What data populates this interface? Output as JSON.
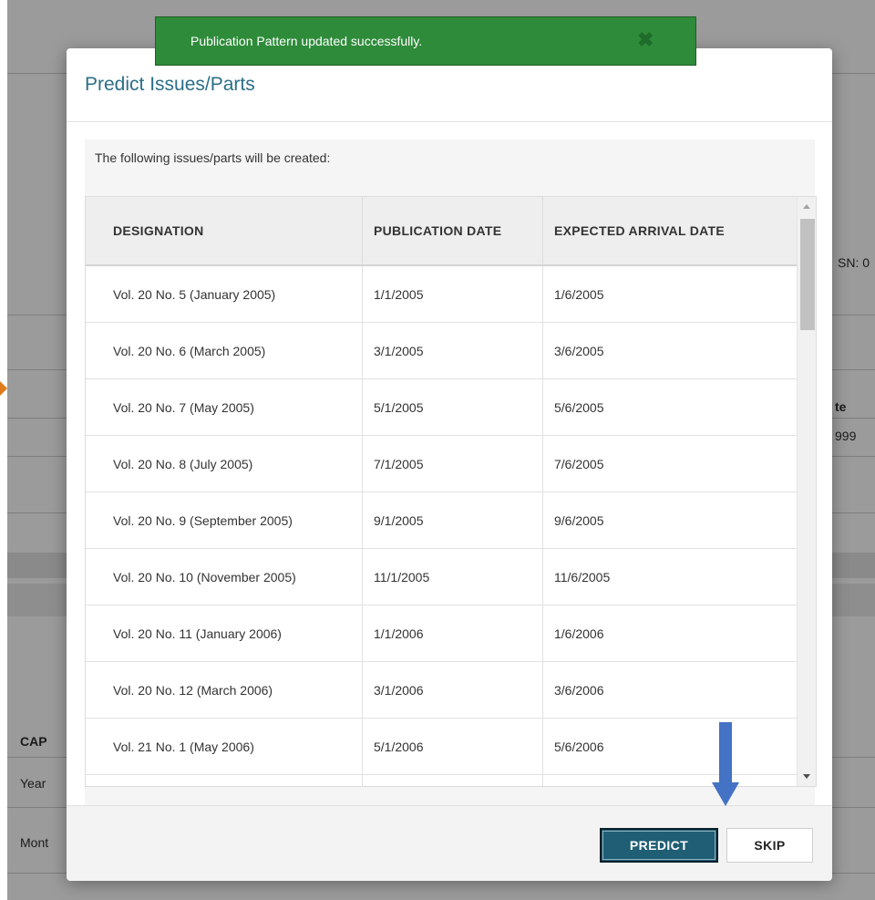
{
  "toast": {
    "message": "Publication Pattern updated successfully.",
    "close_icon": "close-icon"
  },
  "background": {
    "issn_fragment": "SN: 0",
    "date_header_fragment": "te",
    "date_value_fragment": "999",
    "caption_fragment": "CAP",
    "year_fragment": "Year",
    "month_fragment": "Mont"
  },
  "modal": {
    "title": "Predict Issues/Parts",
    "intro": "The following issues/parts will be created:",
    "table": {
      "headers": [
        "DESIGNATION",
        "PUBLICATION DATE",
        "EXPECTED ARRIVAL DATE"
      ],
      "rows": [
        [
          "Vol. 20 No. 5 (January 2005)",
          "1/1/2005",
          "1/6/2005"
        ],
        [
          "Vol. 20 No. 6 (March 2005)",
          "3/1/2005",
          "3/6/2005"
        ],
        [
          "Vol. 20 No. 7 (May 2005)",
          "5/1/2005",
          "5/6/2005"
        ],
        [
          "Vol. 20 No. 8 (July 2005)",
          "7/1/2005",
          "7/6/2005"
        ],
        [
          "Vol. 20 No. 9 (September 2005)",
          "9/1/2005",
          "9/6/2005"
        ],
        [
          "Vol. 20 No. 10 (November 2005)",
          "11/1/2005",
          "11/6/2005"
        ],
        [
          "Vol. 20 No. 11 (January 2006)",
          "1/1/2006",
          "1/6/2006"
        ],
        [
          "Vol. 20 No. 12 (March 2006)",
          "3/1/2006",
          "3/6/2006"
        ],
        [
          "Vol. 21 No. 1 (May 2006)",
          "5/1/2006",
          "5/6/2006"
        ]
      ]
    },
    "buttons": {
      "predict": "PREDICT",
      "skip": "SKIP"
    }
  },
  "annotations": {
    "blue_arrow_color": "#4472c4",
    "orange_arrow_color": "#e07a1c"
  },
  "colors": {
    "toast_bg": "#2e8b3a",
    "title": "#2b6f87",
    "predict_bg": "#1f5e74"
  }
}
